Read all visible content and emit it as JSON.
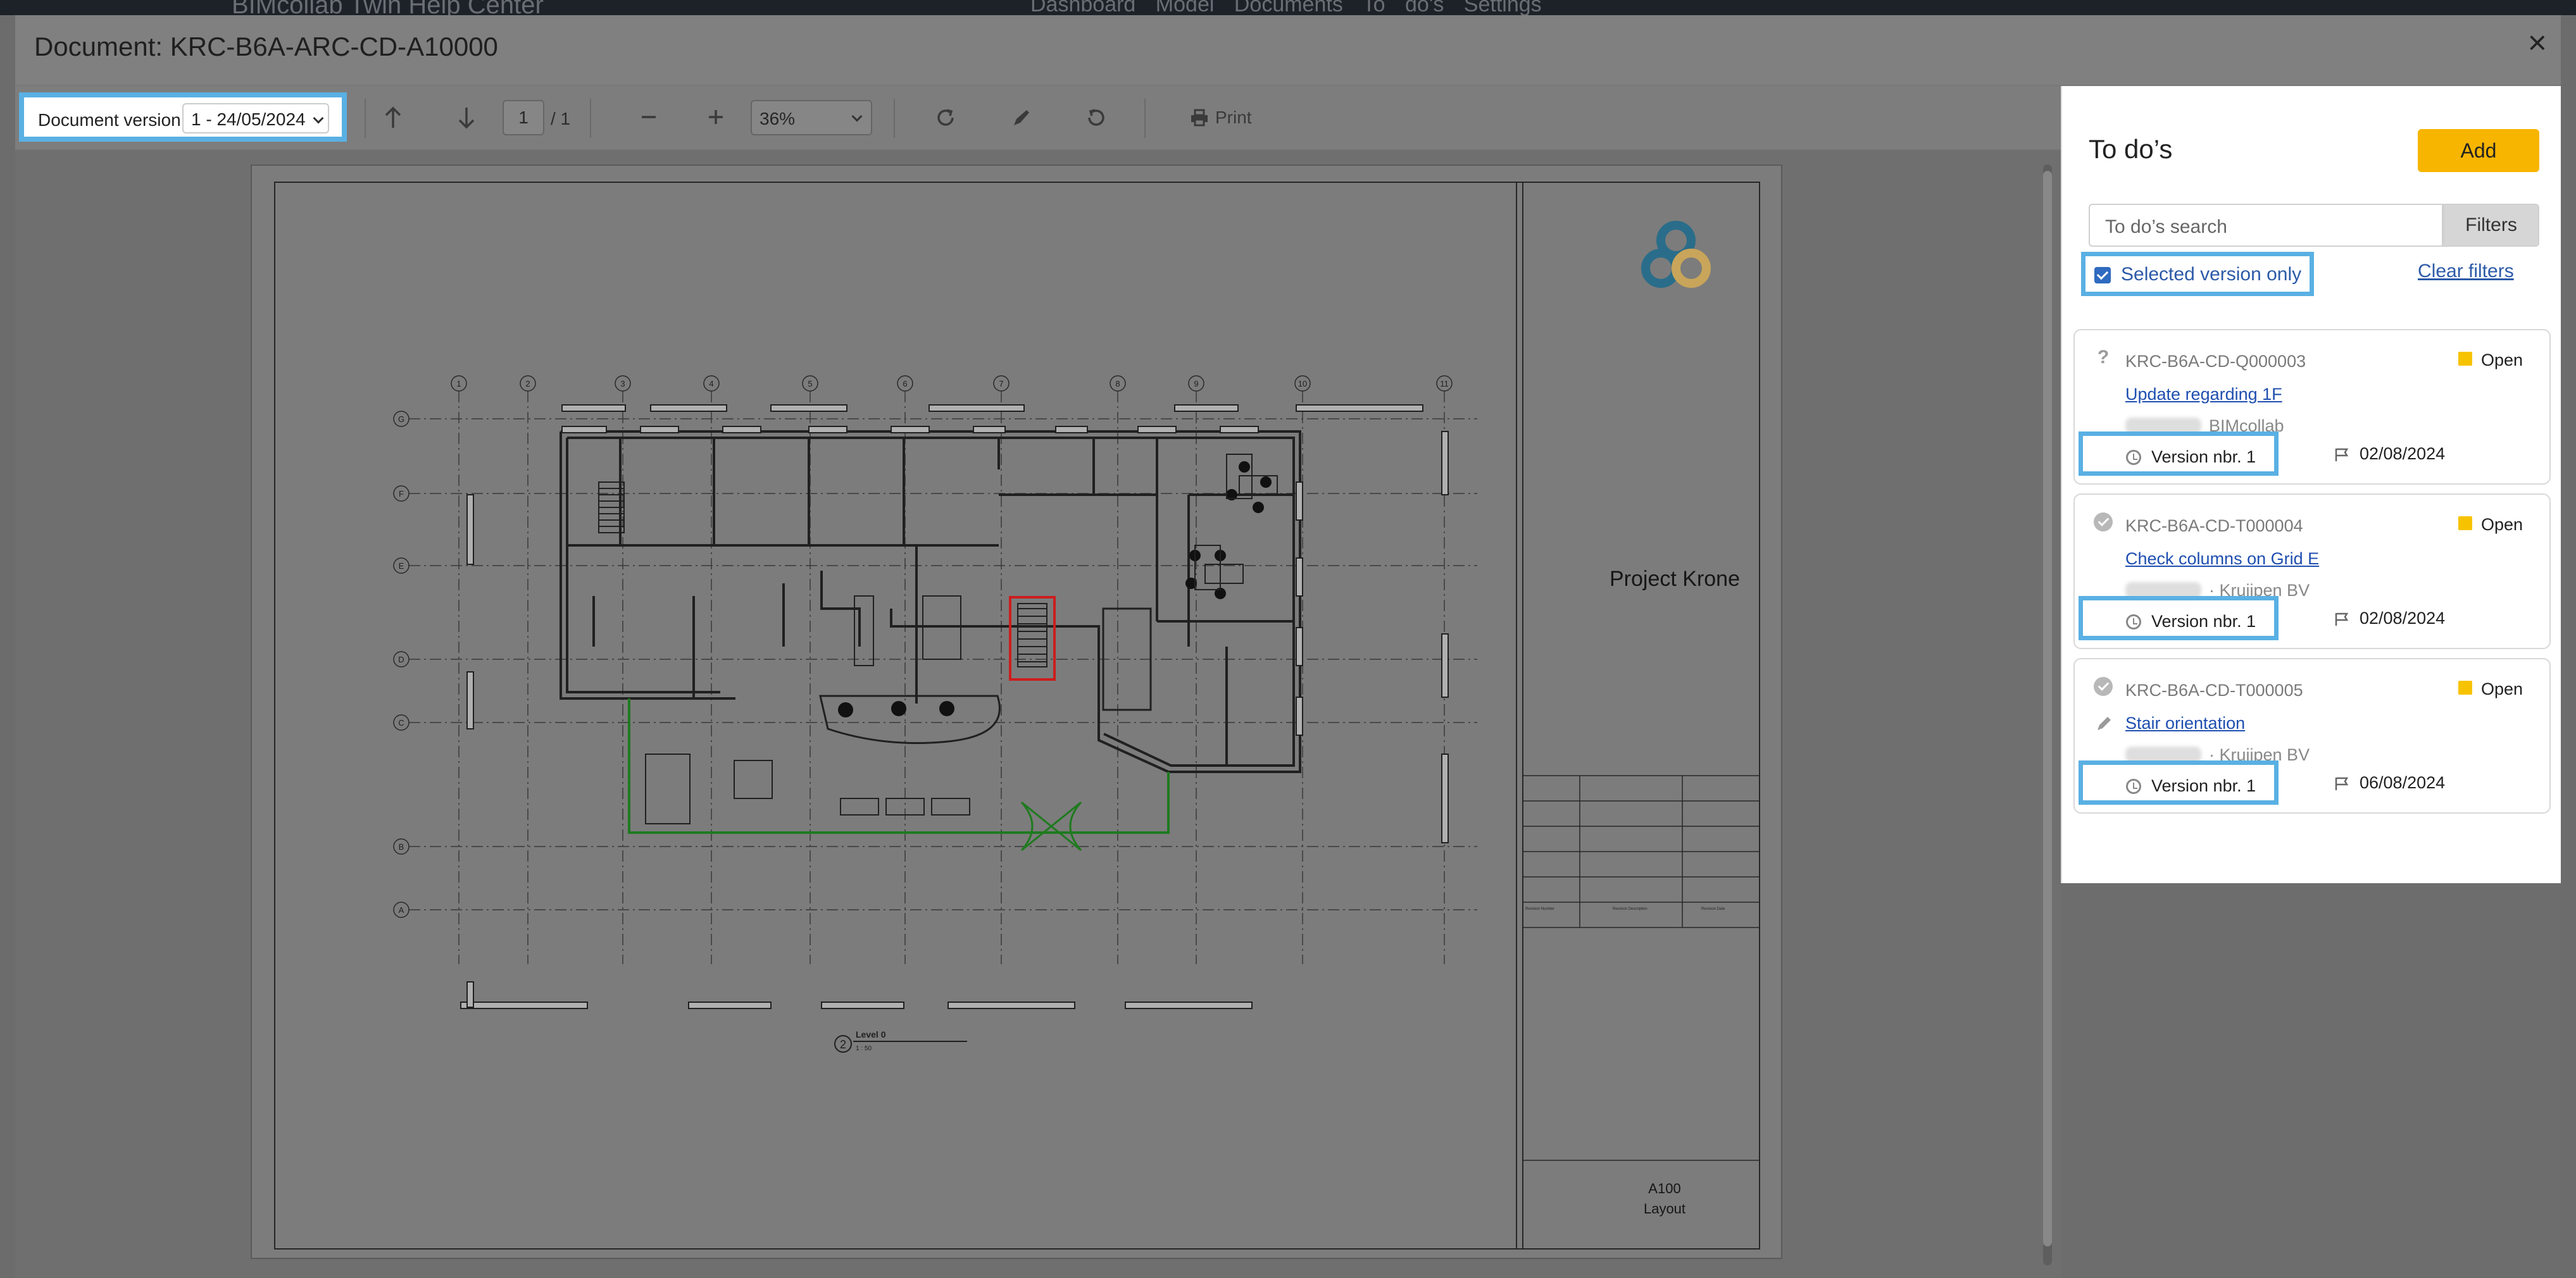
{
  "background": {
    "app_title": "BIMcollab Twin Help Center",
    "nav": [
      "Dashboard",
      "Model",
      "Documents",
      "To do's",
      "Settings"
    ]
  },
  "modal": {
    "title": "Document: KRC-B6A-ARC-CD-A10000",
    "close": "×"
  },
  "toolbar": {
    "version_label": "Document version",
    "version_value": "1 - 24/05/2024",
    "page_current": "1",
    "page_total": "/ 1",
    "zoom": "36%",
    "print_label": "Print"
  },
  "drawing": {
    "project_name": "Project Krone",
    "sheet_number": "A100",
    "sheet_name": "Layout",
    "view_name": "Level 0",
    "view_number": "2",
    "view_scale": "1 : 50",
    "grid_columns": [
      "1",
      "2",
      "3",
      "4",
      "5",
      "6",
      "7",
      "8",
      "9",
      "10",
      "11"
    ],
    "grid_rows": [
      "G",
      "F",
      "E",
      "D",
      "C",
      "B",
      "A"
    ],
    "revision_headers": [
      "Revision Number",
      "Revision Description",
      "Revision Date"
    ],
    "colors": {
      "logo_blue": "#2a6d8a",
      "logo_gold": "#c8a55a",
      "stair_highlight": "#cc1d1d",
      "path_green": "#1f7a1f"
    }
  },
  "todo": {
    "title": "To do’s",
    "add_label": "Add",
    "search_placeholder": "To do’s search",
    "filters_label": "Filters",
    "selected_version_label": "Selected version only",
    "selected_version_checked": true,
    "clear_filters_label": "Clear filters",
    "items": [
      {
        "type_icon": "question-icon",
        "id": "KRC-B6A-CD-Q000003",
        "status": "Open",
        "title": "Update regarding 1F",
        "company": "BIMcollab",
        "version": "Version nbr. 1",
        "date": "02/08/2024"
      },
      {
        "type_icon": "check-circle-icon",
        "id": "KRC-B6A-CD-T000004",
        "status": "Open",
        "title": "Check columns on Grid E",
        "company": "· Kruijpen BV",
        "version": "Version nbr. 1",
        "date": "02/08/2024"
      },
      {
        "type_icon": "check-circle-icon",
        "id": "KRC-B6A-CD-T000005",
        "status": "Open",
        "title": "Stair orientation",
        "company": "· Kruijpen BV",
        "version": "Version nbr. 1",
        "date": "06/08/2024"
      }
    ]
  }
}
